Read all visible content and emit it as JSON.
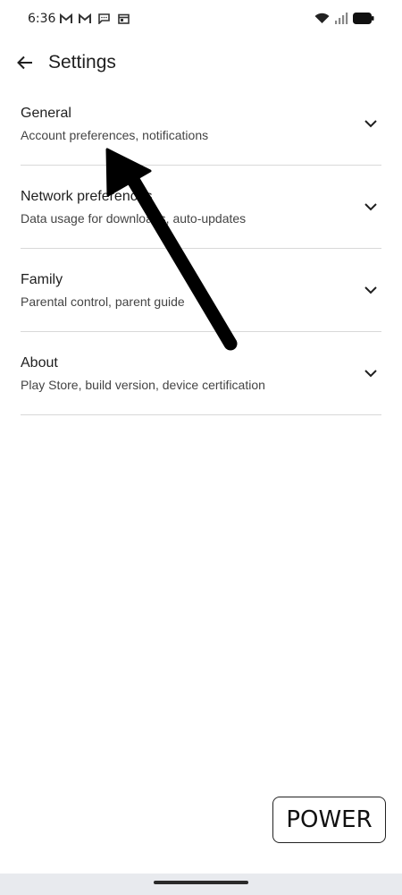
{
  "status_bar": {
    "time": "6:36",
    "icons": [
      "gmail-icon",
      "gmail-icon",
      "message-icon",
      "calendar-icon",
      "wifi-icon",
      "signal-icon",
      "battery-icon"
    ]
  },
  "app_bar": {
    "title": "Settings",
    "back_icon": "arrow-back-icon"
  },
  "settings": {
    "items": [
      {
        "title": "General",
        "subtitle": "Account preferences, notifications"
      },
      {
        "title": "Network preferences",
        "subtitle": "Data usage for downloads, auto-updates"
      },
      {
        "title": "Family",
        "subtitle": "Parental control, parent guide"
      },
      {
        "title": "About",
        "subtitle": "Play Store, build version, device certification"
      }
    ],
    "chevron_icon": "chevron-down-icon"
  },
  "power_button": {
    "label": "POWER"
  },
  "colors": {
    "background": "#ffffff",
    "divider": "#d8d8d8",
    "text_primary": "#1f1f1f",
    "text_secondary": "#444444",
    "nav_bar": "#e8eaee",
    "arrow": "#000000"
  }
}
